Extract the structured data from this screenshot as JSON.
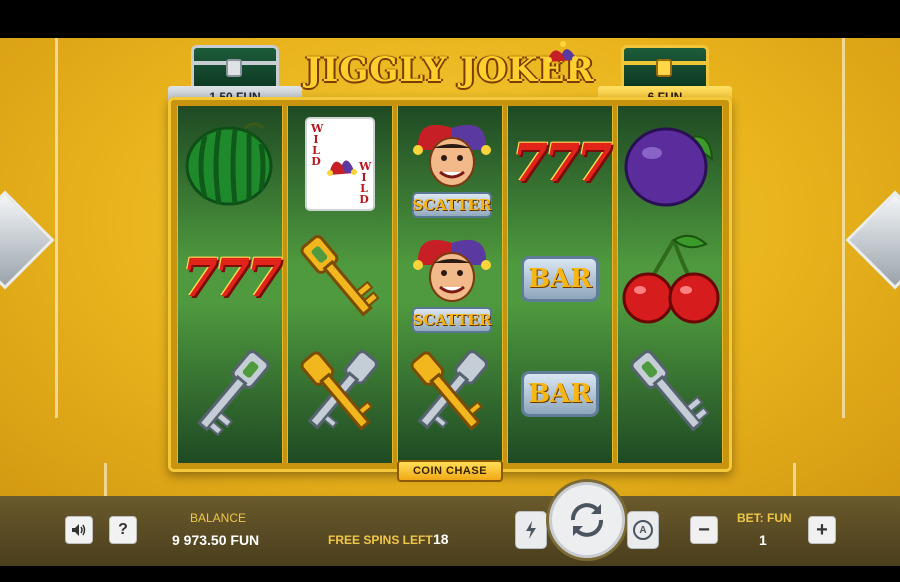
{
  "game": {
    "title": "JIGGLY JOKER",
    "chests": {
      "left_value": "1.50 FUN",
      "right_value": "6 FUN"
    },
    "feature_label": "COIN CHASE",
    "reels": [
      [
        "watermelon-icon",
        "seven-seven-seven-icon",
        "silver-key-icon"
      ],
      [
        "wild-card-icon",
        "gold-key-icon",
        "crossed-keys-icon"
      ],
      [
        "joker-scatter-icon",
        "joker-scatter-icon",
        "crossed-keys-icon"
      ],
      [
        "seven-seven-seven-icon",
        "bar-icon",
        "bar-icon"
      ],
      [
        "plum-icon",
        "cherry-icon",
        "silver-key-icon"
      ]
    ],
    "symbol_text": {
      "seven": "777",
      "bar": "BAR",
      "scatter": "SCATTER",
      "wild": "WILD"
    }
  },
  "hud": {
    "sound_icon": "speaker-icon",
    "help_label": "?",
    "balance_label": "BALANCE",
    "balance_value": "9 973.50 FUN",
    "free_spins_label": "FREE SPINS LEFT",
    "free_spins_value": "18",
    "turbo_icon": "lightning-icon",
    "spin_icon": "spin-arrows-icon",
    "autoplay_icon": "autoplay-icon",
    "autoplay_letter": "A",
    "bet_label": "BET: FUN",
    "bet_value": "1",
    "minus_label": "−",
    "plus_label": "+"
  },
  "colors": {
    "background_gold": "#e8b21c",
    "reel_green": "#4f9a3e",
    "label_gold": "#f0c64a",
    "seven_red": "#e2231a"
  }
}
